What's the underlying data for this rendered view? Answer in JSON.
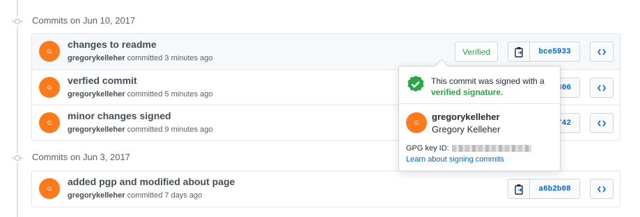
{
  "groups": [
    {
      "header": "Commits on Jun 10, 2017",
      "commits": [
        {
          "title": "changes to readme",
          "author": "gregorykelleher",
          "time": "committed 3 minutes ago",
          "sha": "bce5933",
          "avatar_initial": "G"
        },
        {
          "title": "verfied commit",
          "author": "gregorykelleher",
          "time": "committed 5 minutes ago",
          "sha": "306",
          "avatar_initial": "G"
        },
        {
          "title": "minor changes signed",
          "author": "gregorykelleher",
          "time": "committed 9 minutes ago",
          "sha": "742",
          "avatar_initial": "G"
        }
      ]
    },
    {
      "header": "Commits on Jun 3, 2017",
      "commits": [
        {
          "title": "added pgp and modified about page",
          "author": "gregorykelleher",
          "time": "committed 7 days ago",
          "sha": "a6b2b08",
          "avatar_initial": "G"
        }
      ]
    }
  ],
  "verified_badge": "Verified",
  "popover": {
    "message": "This commit was signed with a",
    "verified_link": "verified signature.",
    "login": "gregorykelleher",
    "name": "Gregory Kelleher",
    "avatar_initial": "G",
    "gpg_label": "GPG key ID:",
    "learn_link": "Learn about signing commits"
  },
  "colors": {
    "accent": "#0366d6",
    "verified": "#28a745",
    "avatar": "#ff7a1a"
  },
  "icons": {
    "timeline": "git-commit-icon",
    "copy": "clippy-icon",
    "browse": "code-icon",
    "verified": "verified-check-icon"
  }
}
